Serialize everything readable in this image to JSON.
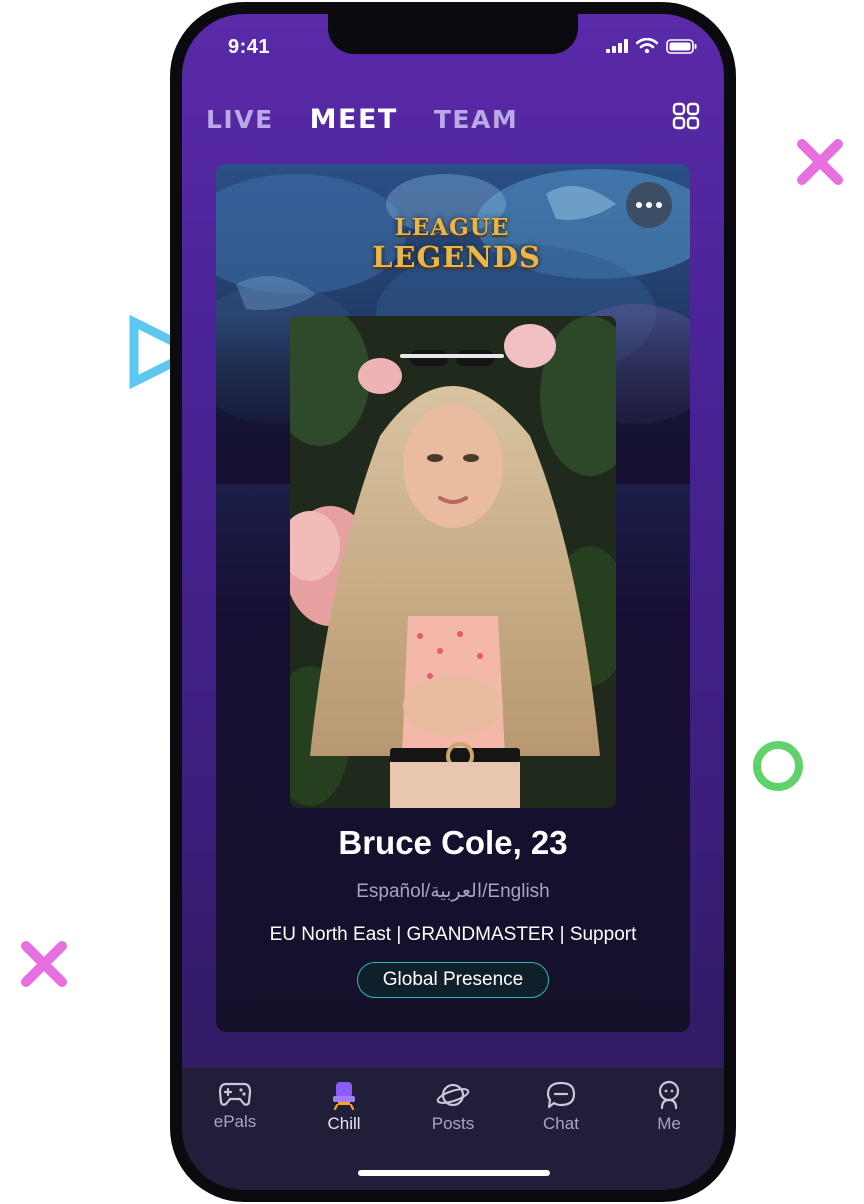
{
  "status_bar": {
    "time": "9:41"
  },
  "nav": {
    "tabs": [
      {
        "label": "LIVE",
        "active": false
      },
      {
        "label": "MEET",
        "active": true
      },
      {
        "label": "TEAM",
        "active": false
      }
    ],
    "grid_icon": "grid-icon"
  },
  "card": {
    "game_logo": {
      "line1": "LEAGUE",
      "line2": "LEGENDS"
    },
    "more_icon": "more-icon",
    "profile": {
      "name": "Bruce Cole, 23",
      "languages": "Español/العربية/English",
      "details": "EU North East | GRANDMASTER | Support",
      "badge": "Global Presence"
    }
  },
  "tabbar": {
    "items": [
      {
        "label": "ePals",
        "icon": "gamepad-icon",
        "active": false
      },
      {
        "label": "Chill",
        "icon": "chair-icon",
        "active": true
      },
      {
        "label": "Posts",
        "icon": "planet-icon",
        "active": false
      },
      {
        "label": "Chat",
        "icon": "chat-icon",
        "active": false
      },
      {
        "label": "Me",
        "icon": "person-icon",
        "active": false
      }
    ]
  },
  "colors": {
    "accent_purple": "#5a2aa8",
    "badge_border": "#2fb9b5",
    "chill_icon": "#8b5cf6",
    "chill_seat": "#f5a623",
    "deco_pink": "#e86fe0",
    "deco_blue": "#5cc8f0",
    "deco_green": "#5fd36a"
  }
}
